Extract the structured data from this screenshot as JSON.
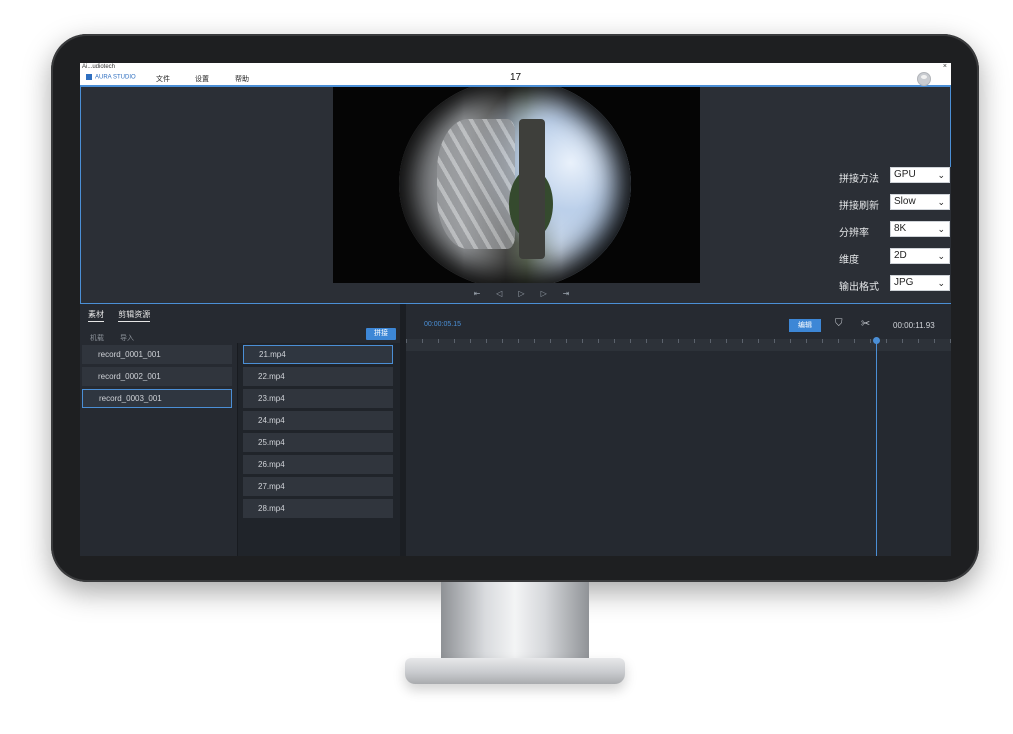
{
  "window": {
    "title": "Ai...udiotech",
    "close_glyph": "×"
  },
  "menubar": {
    "brand": "AURA STUDIO",
    "items": [
      "文件",
      "设置",
      "帮助"
    ],
    "center_label": "17"
  },
  "player": {
    "controls": [
      "⇤",
      "◁",
      "▷",
      "▷",
      "⇥"
    ]
  },
  "settings": [
    {
      "label": "拼接方法",
      "value": "GPU"
    },
    {
      "label": "拼接刷新",
      "value": "Slow"
    },
    {
      "label": "分辨率",
      "value": "8K"
    },
    {
      "label": "维度",
      "value": "2D"
    },
    {
      "label": "输出格式",
      "value": "JPG"
    }
  ],
  "library": {
    "tabs": [
      "素材",
      "剪辑资源"
    ],
    "subtabs": [
      "机载",
      "导入"
    ],
    "stitch_button": "拼接",
    "records": [
      "record_0001_001",
      "record_0002_001",
      "record_0003_001"
    ],
    "active_record": 2,
    "files": [
      "21.mp4",
      "22.mp4",
      "23.mp4",
      "24.mp4",
      "25.mp4",
      "26.mp4",
      "27.mp4",
      "28.mp4"
    ],
    "active_file": 0
  },
  "timeline": {
    "current_time": "00:00:05.15",
    "edit_button": "编辑",
    "marker_icon": "marker-icon",
    "cut_icon": "scissors-icon",
    "total_time": "00:00:11.93"
  },
  "colors": {
    "accent": "#3d87d6",
    "panel": "#262a31",
    "frame": "#1e1f21"
  }
}
